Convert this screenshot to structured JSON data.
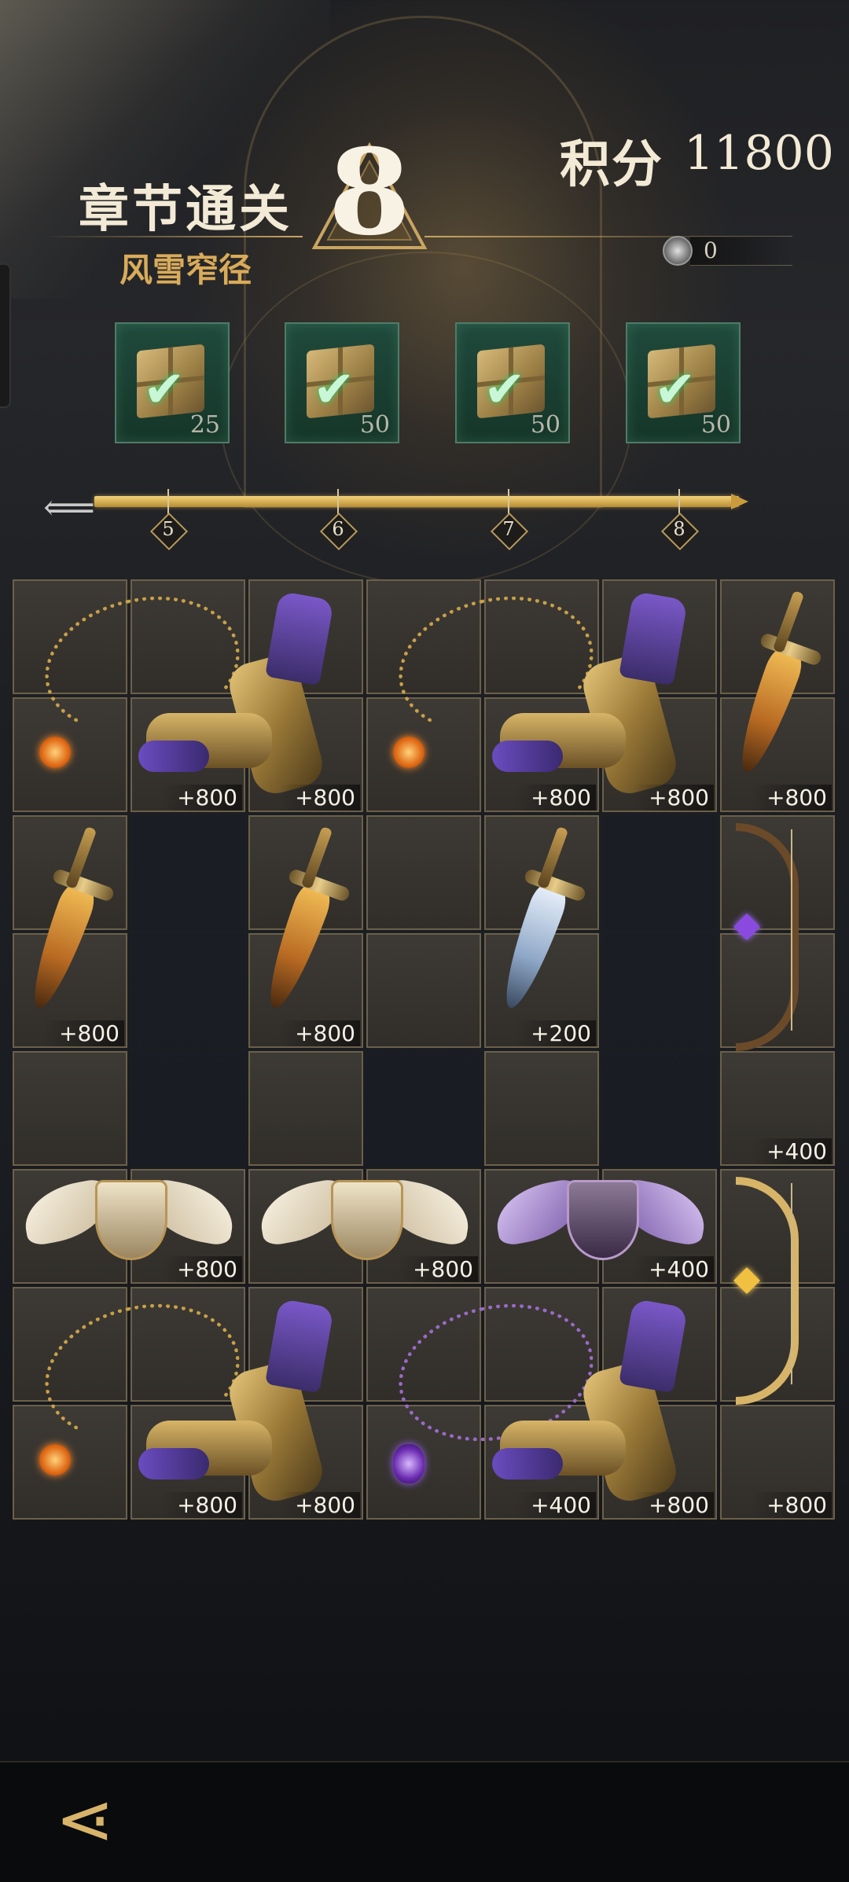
{
  "header": {
    "chapter_title": "章节通关",
    "chapter_number": "8",
    "chapter_subtitle": "风雪窄径",
    "score_label": "积分",
    "score_value": "11800",
    "token_value": "0",
    "token_icon": "coin-icon"
  },
  "rewards": [
    {
      "value": "25",
      "claimed": true,
      "icon": "chest-icon"
    },
    {
      "value": "50",
      "claimed": true,
      "icon": "chest-icon"
    },
    {
      "value": "50",
      "claimed": true,
      "icon": "chest-icon"
    },
    {
      "value": "50",
      "claimed": true,
      "icon": "chest-icon"
    }
  ],
  "progress": {
    "milestones": [
      "5",
      "6",
      "7",
      "8"
    ],
    "fill_fraction": 1.0
  },
  "items": [
    {
      "type": "necklace-orange",
      "points": "+800"
    },
    {
      "type": "gauntlet",
      "points": "+800"
    },
    {
      "type": "necklace-orange",
      "points": "+800"
    },
    {
      "type": "gauntlet",
      "points": "+800"
    },
    {
      "type": "dagger-gold",
      "points": "+800"
    },
    {
      "type": "dagger-gold",
      "points": "+800"
    },
    {
      "type": "dagger-gold",
      "points": "+800"
    },
    {
      "type": "dagger-silver",
      "points": "+200"
    },
    {
      "type": "bow-dark",
      "points": "+400"
    },
    {
      "type": "shield-white",
      "points": "+800"
    },
    {
      "type": "shield-white",
      "points": "+800"
    },
    {
      "type": "shield-purple",
      "points": "+400"
    },
    {
      "type": "necklace-orange",
      "points": "+800"
    },
    {
      "type": "gauntlet",
      "points": "+800"
    },
    {
      "type": "necklace-purple",
      "points": "+400"
    },
    {
      "type": "gauntlet",
      "points": "+800"
    },
    {
      "type": "bow-gold",
      "points": "+800"
    }
  ],
  "nav": {
    "back_icon": "back-arrow-icon"
  },
  "colors": {
    "gold": "#d8b46a",
    "chest_green": "#1f4a3c",
    "cell_border": "#6b6049"
  }
}
